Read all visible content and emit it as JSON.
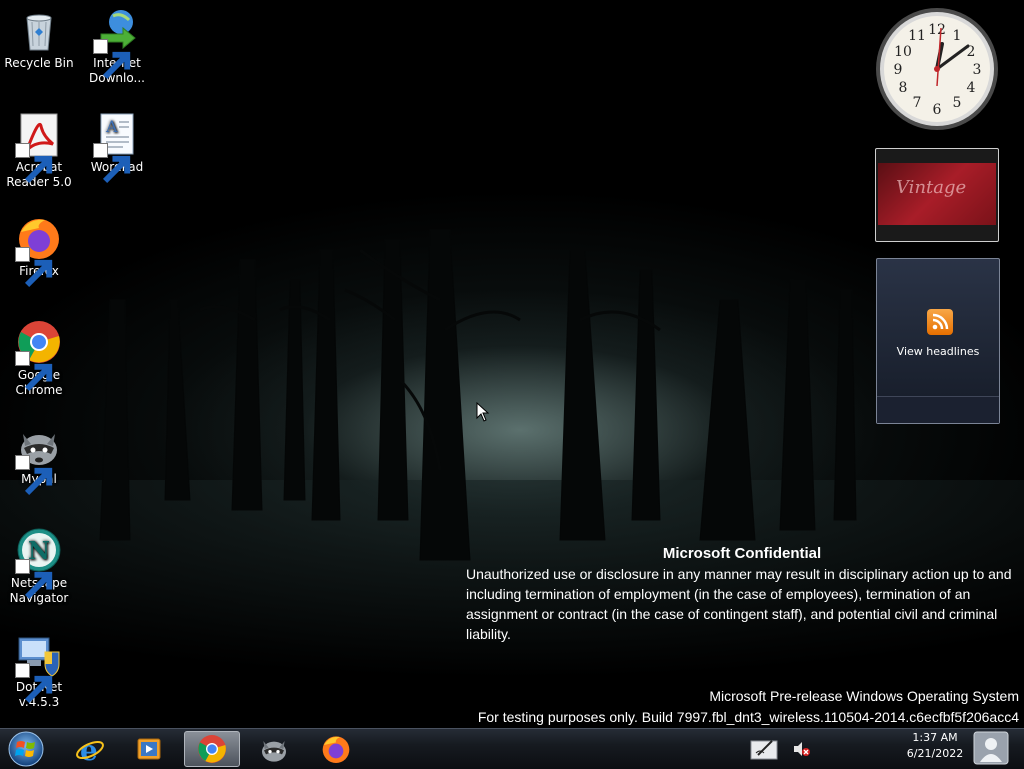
{
  "desktop_icons": [
    {
      "label": "Recycle Bin",
      "icon": "recycle-bin-icon",
      "shortcut": false
    },
    {
      "label": "Internet\nDownlo...",
      "icon": "internet-download-manager-icon",
      "shortcut": true
    },
    {
      "label": "Acrobat\nReader 5.0",
      "icon": "acrobat-reader-icon",
      "shortcut": true
    },
    {
      "label": "WordPad",
      "icon": "wordpad-icon",
      "shortcut": true
    },
    {
      "label": "Firefox",
      "icon": "firefox-icon",
      "shortcut": true
    },
    {
      "label": "Google\nChrome",
      "icon": "chrome-icon",
      "shortcut": true
    },
    {
      "label": "Mypal",
      "icon": "mypal-icon",
      "shortcut": true
    },
    {
      "label": "Netscape\nNavigator",
      "icon": "netscape-icon",
      "shortcut": true
    },
    {
      "label": "Dot Net\nv.4.5.3",
      "icon": "dotnet-installer-icon",
      "shortcut": true
    }
  ],
  "gadgets": {
    "clock": {
      "numbers": [
        "12",
        "1",
        "2",
        "3",
        "4",
        "5",
        "6",
        "7",
        "8",
        "9",
        "10",
        "11"
      ]
    },
    "slideshow": {
      "caption": "Vintage"
    },
    "feed_headlines": {
      "label": "View headlines"
    }
  },
  "watermark": {
    "title": "Microsoft Confidential",
    "body": "Unauthorized use or disclosure in any manner may result in disciplinary action up to and including termination of employment (in the case of employees), termination of an assignment or contract (in the case of contingent staff), and potential civil and criminal liability.",
    "os_name": "Microsoft Pre-release Windows Operating System",
    "build": "For testing purposes only. Build 7997.fbl_dnt3_wireless.110504-2014.c6ecfbf5f206acc4"
  },
  "taskbar": {
    "pinned": [
      "internet-explorer-icon",
      "media-player-icon",
      "chrome-icon",
      "mypal-icon",
      "firefox-icon"
    ],
    "active": "chrome-icon"
  },
  "tray": {
    "time": "1:37 AM",
    "date": "6/21/2022",
    "icons": [
      "pen-tablet-icon",
      "volume-muted-icon"
    ]
  },
  "colors": {
    "taskbar": "#161a20",
    "accent": "#e66f00"
  }
}
